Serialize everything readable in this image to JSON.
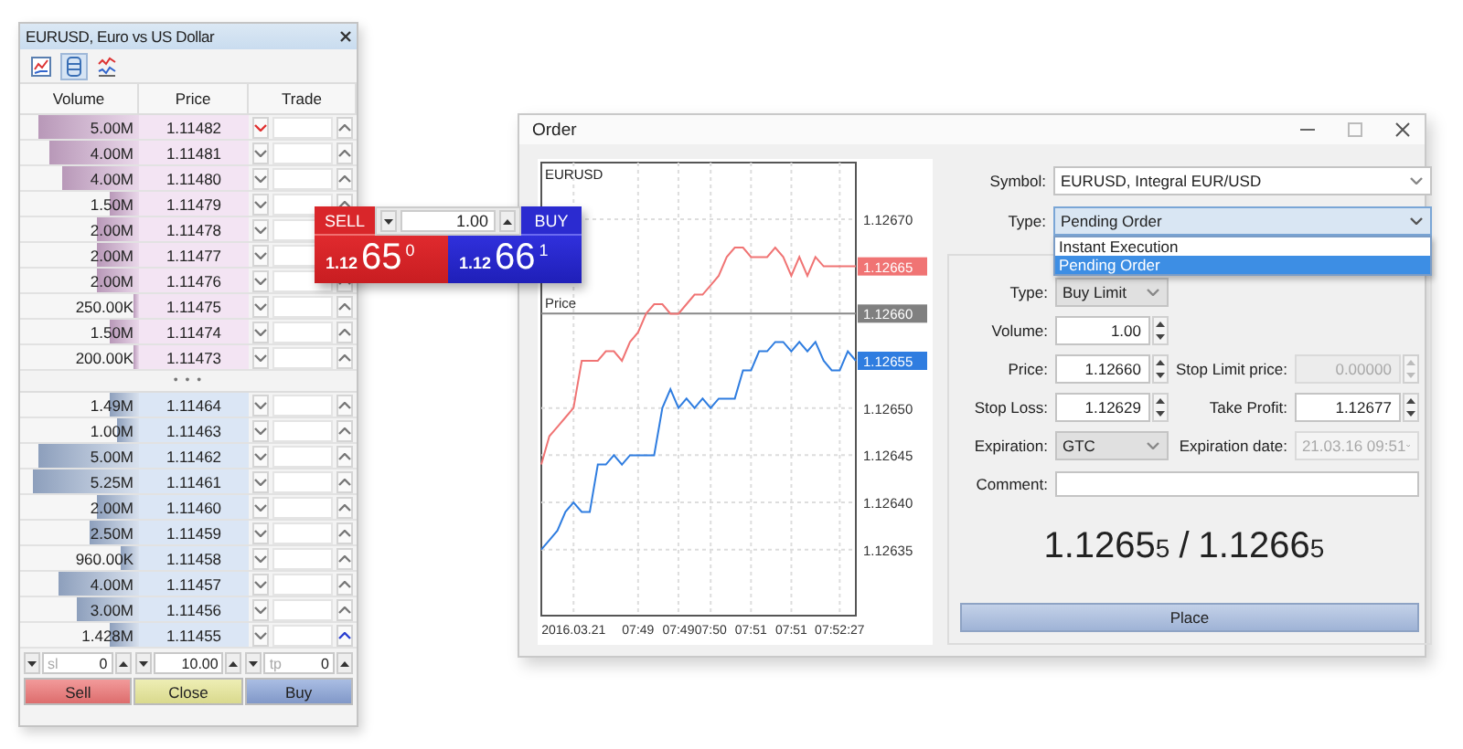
{
  "market_watch": {
    "title": "EURUSD, Euro vs US Dollar",
    "toolbar": [
      {
        "kind": "chart",
        "selected": false
      },
      {
        "kind": "depth",
        "selected": true
      },
      {
        "kind": "ticks",
        "selected": false
      }
    ],
    "columns": [
      "Volume",
      "Price",
      "Trade"
    ],
    "ask_rows": [
      {
        "volume": "5.00M",
        "price": "1.11482",
        "level": 0.85,
        "active": true
      },
      {
        "volume": "4.00M",
        "price": "1.11481",
        "level": 0.75,
        "active": false
      },
      {
        "volume": "4.00M",
        "price": "1.11480",
        "level": 0.65,
        "active": false
      },
      {
        "volume": "1.50M",
        "price": "1.11479",
        "level": 0.25,
        "active": false
      },
      {
        "volume": "2.00M",
        "price": "1.11478",
        "level": 0.35,
        "active": false
      },
      {
        "volume": "2.00M",
        "price": "1.11477",
        "level": 0.35,
        "active": false
      },
      {
        "volume": "2.00M",
        "price": "1.11476",
        "level": 0.35,
        "active": false
      },
      {
        "volume": "250.00K",
        "price": "1.11475",
        "level": 0.05,
        "active": false
      },
      {
        "volume": "1.50M",
        "price": "1.11474",
        "level": 0.25,
        "active": false
      },
      {
        "volume": "200.00K",
        "price": "1.11473",
        "level": 0.04,
        "active": false
      }
    ],
    "separator": "• • •",
    "bid_rows": [
      {
        "volume": "1.49M",
        "price": "1.11464",
        "level": 0.25,
        "active": false
      },
      {
        "volume": "1.00M",
        "price": "1.11463",
        "level": 0.18,
        "active": false
      },
      {
        "volume": "5.00M",
        "price": "1.11462",
        "level": 0.85,
        "active": false
      },
      {
        "volume": "5.25M",
        "price": "1.11461",
        "level": 0.9,
        "active": false
      },
      {
        "volume": "2.00M",
        "price": "1.11460",
        "level": 0.35,
        "active": false
      },
      {
        "volume": "2.50M",
        "price": "1.11459",
        "level": 0.42,
        "active": false
      },
      {
        "volume": "960.00K",
        "price": "1.11458",
        "level": 0.15,
        "active": false
      },
      {
        "volume": "4.00M",
        "price": "1.11457",
        "level": 0.68,
        "active": false
      },
      {
        "volume": "3.00M",
        "price": "1.11456",
        "level": 0.52,
        "active": false
      },
      {
        "volume": "1.428M",
        "price": "1.11455",
        "level": 0.25,
        "active": true
      }
    ],
    "stop_loss": {
      "label": "sl",
      "value": "0"
    },
    "volume": "10.00",
    "take_profit": {
      "label": "tp",
      "value": "0"
    },
    "buttons": [
      {
        "kind": "sell",
        "label": "Sell"
      },
      {
        "kind": "close",
        "label": "Close"
      },
      {
        "kind": "buy",
        "label": "Buy"
      }
    ]
  },
  "one_click": {
    "sell": {
      "label": "SELL",
      "prefix": "1.12",
      "big": "65",
      "small": "0"
    },
    "volume": "1.00",
    "buy": {
      "label": "BUY",
      "prefix": "1.12",
      "big": "66",
      "small": "1"
    }
  },
  "order": {
    "title": "Order",
    "chart": {
      "symbol": "EURUSD",
      "price_tags": [
        {
          "label": "1.12665",
          "color": "#f07474"
        },
        {
          "label": "1.12660",
          "color": "#808080"
        },
        {
          "label": "1.12655",
          "color": "#2f7de0"
        }
      ],
      "chart_data": {
        "type": "line",
        "grid": true,
        "categories": [
          null,
          null,
          null,
          null,
          "2016.03.21",
          null,
          null,
          null,
          null,
          null,
          null,
          null,
          "07:49",
          null,
          null,
          null,
          null,
          "07:49",
          null,
          null,
          null,
          "07:50",
          null,
          null,
          null,
          null,
          "07:51",
          null,
          null,
          null,
          null,
          "07:51",
          null,
          null,
          null,
          null,
          null,
          "07:52:27",
          null,
          null
        ],
        "ylim": [
          1.12628,
          1.12676
        ],
        "yticks": [
          {
            "value": 1.12635,
            "label": "1.12635"
          },
          {
            "value": 1.1264,
            "label": "1.12640"
          },
          {
            "value": 1.12645,
            "label": "1.12645"
          },
          {
            "value": 1.1265,
            "label": "1.12650"
          },
          {
            "value": 1.1267,
            "label": "1.12670"
          }
        ],
        "ref_lines": [
          {
            "axis": "y",
            "value": 1.1266,
            "label": "Price"
          }
        ],
        "series": [
          {
            "color": "#f07474",
            "values": [
              1.12644,
              1.12647,
              1.12648,
              1.12649,
              1.1265,
              1.12655,
              1.12655,
              1.12655,
              1.12656,
              1.12656,
              1.12655,
              1.12657,
              1.12658,
              1.1266,
              1.12661,
              1.12661,
              1.1266,
              1.1266,
              1.12661,
              1.12662,
              1.12662,
              1.12663,
              1.12664,
              1.12666,
              1.12667,
              1.12667,
              1.12666,
              1.12666,
              1.12666,
              1.12667,
              1.12666,
              1.12664,
              1.12666,
              1.12664,
              1.12666,
              1.12665,
              1.12665,
              1.12665,
              1.12665,
              1.12665
            ]
          },
          {
            "color": "#2f7de0",
            "values": [
              1.12635,
              1.12636,
              1.12637,
              1.12639,
              1.1264,
              1.12639,
              1.12639,
              1.12644,
              1.12644,
              1.12645,
              1.12644,
              1.12645,
              1.12645,
              1.12645,
              1.12645,
              1.1265,
              1.12652,
              1.1265,
              1.12651,
              1.1265,
              1.12651,
              1.1265,
              1.12651,
              1.12651,
              1.12651,
              1.12654,
              1.12654,
              1.12656,
              1.12656,
              1.12657,
              1.12657,
              1.12656,
              1.12657,
              1.12656,
              1.12657,
              1.12655,
              1.12654,
              1.12654,
              1.12656,
              1.12655
            ]
          }
        ]
      }
    },
    "symbol": {
      "label": "Symbol:",
      "value": "EURUSD, Integral EUR/USD"
    },
    "type": {
      "label": "Type:",
      "value": "Pending Order",
      "expanded": true,
      "options": [
        {
          "label": "Instant Execution",
          "selected": false
        },
        {
          "label": "Pending Order",
          "selected": true
        }
      ]
    },
    "rows": [
      {
        "cells": [
          {
            "label": "Type:",
            "value": "Buy Limit",
            "kind": "select",
            "disabled": false
          }
        ]
      },
      {
        "cells": [
          {
            "label": "Volume:",
            "value": "1.00",
            "kind": "spin",
            "disabled": false
          }
        ]
      },
      {
        "cells": [
          {
            "label": "Price:",
            "value": "1.12660",
            "kind": "spin",
            "disabled": false
          },
          {
            "label": "Stop Limit price:",
            "value": "0.00000",
            "kind": "spin",
            "disabled": true
          }
        ]
      },
      {
        "cells": [
          {
            "label": "Stop Loss:",
            "value": "1.12629",
            "kind": "spin",
            "disabled": false
          },
          {
            "label": "Take Profit:",
            "value": "1.12677",
            "kind": "spin",
            "disabled": false
          }
        ]
      },
      {
        "cells": [
          {
            "label": "Expiration:",
            "value": "GTC",
            "kind": "select",
            "disabled": false
          },
          {
            "label": "Expiration date:",
            "value": "21.03.16 09:51",
            "kind": "select",
            "disabled": true
          }
        ]
      },
      {
        "cells": [
          {
            "label": "Comment:",
            "kind": "wide",
            "disabled": false
          }
        ]
      }
    ],
    "quote": {
      "bid": "1.1265",
      "bid_pip": "5",
      "separator": "/",
      "ask": "1.1266",
      "ask_pip": "5"
    },
    "button": "Place"
  }
}
